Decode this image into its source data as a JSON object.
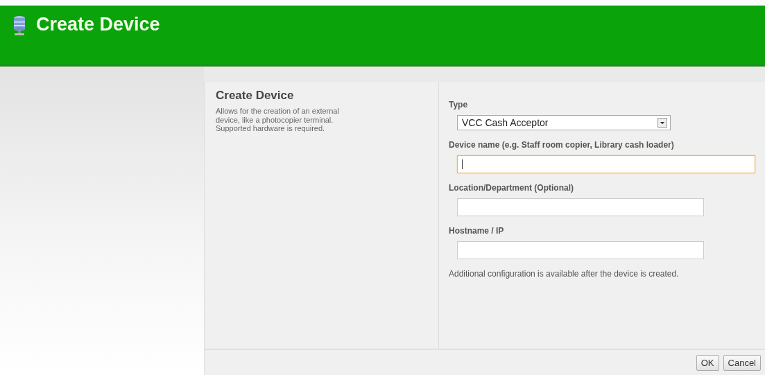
{
  "header": {
    "title": "Create Device"
  },
  "intro": {
    "heading": "Create Device",
    "description": "Allows for the creation of an external device, like a photocopier terminal. Supported hardware is required."
  },
  "fields": [
    {
      "kind": "select",
      "label": "Type",
      "value": "VCC Cash Acceptor",
      "focused": false
    },
    {
      "kind": "text",
      "label": "Device name (e.g. Staff room copier, Library cash loader)",
      "focused": true
    },
    {
      "kind": "text",
      "label": "Location/Department (Optional)",
      "focused": false
    },
    {
      "kind": "text",
      "label": "Hostname / IP",
      "focused": false
    }
  ],
  "note": "Additional configuration is available after the device is created.",
  "buttons": [
    "OK",
    "Cancel"
  ]
}
